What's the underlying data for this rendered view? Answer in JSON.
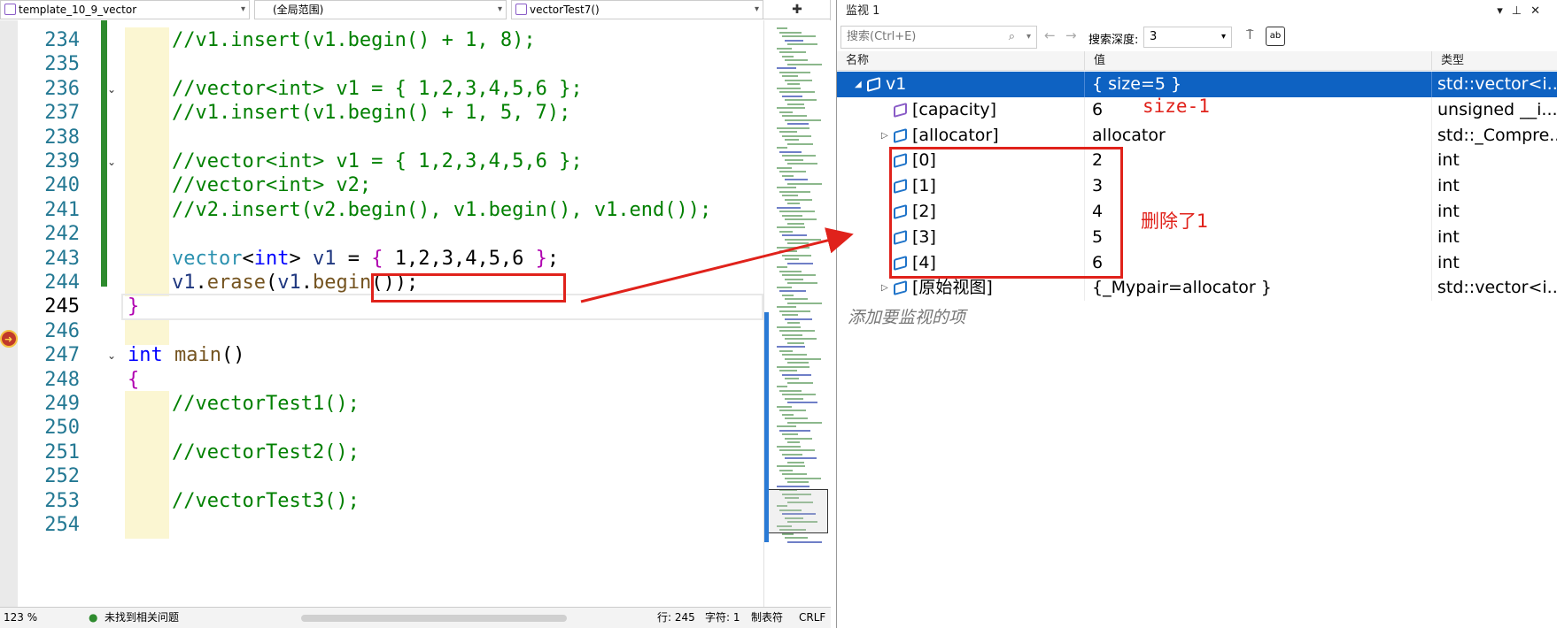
{
  "editor": {
    "dropdowns": [
      "template_10_9_vector",
      "(全局范围)",
      "vectorTest7()"
    ],
    "lines": [
      {
        "num": "234",
        "code": "//v1.insert(v1.begin() + 1, 8);",
        "kind": "comment"
      },
      {
        "num": "235",
        "code": "",
        "kind": "blank"
      },
      {
        "num": "236",
        "code": "//vector<int> v1 = { 1,2,3,4,5,6 };",
        "kind": "comment"
      },
      {
        "num": "237",
        "code": "//v1.insert(v1.begin() + 1, 5, 7);",
        "kind": "comment"
      },
      {
        "num": "238",
        "code": "",
        "kind": "blank"
      },
      {
        "num": "239",
        "code": "//vector<int> v1 = { 1,2,3,4,5,6 };",
        "kind": "comment"
      },
      {
        "num": "240",
        "code": "//vector<int> v2;",
        "kind": "comment"
      },
      {
        "num": "241",
        "code": "//v2.insert(v2.begin(), v1.begin(), v1.end());",
        "kind": "comment"
      },
      {
        "num": "242",
        "code": "",
        "kind": "blank"
      },
      {
        "num": "243",
        "code": "vector<int> v1 = { 1,2,3,4,5,6 };",
        "kind": "code"
      },
      {
        "num": "244",
        "code": "v1.erase(v1.begin());",
        "kind": "code"
      },
      {
        "num": "245",
        "code": "}",
        "kind": "code"
      },
      {
        "num": "246",
        "code": "",
        "kind": "blank"
      },
      {
        "num": "247",
        "code": "int main()",
        "kind": "code"
      },
      {
        "num": "248",
        "code": "{",
        "kind": "code"
      },
      {
        "num": "249",
        "code": "//vectorTest1();",
        "kind": "comment"
      },
      {
        "num": "250",
        "code": "",
        "kind": "blank"
      },
      {
        "num": "251",
        "code": "//vectorTest2();",
        "kind": "comment"
      },
      {
        "num": "252",
        "code": "",
        "kind": "blank"
      },
      {
        "num": "253",
        "code": "//vectorTest3();",
        "kind": "comment"
      },
      {
        "num": "254",
        "code": "",
        "kind": "blank"
      }
    ],
    "status": {
      "zoom": "123 %",
      "issues": "未找到相关问题",
      "line": "行: 245",
      "char": "字符: 1",
      "tab": "制表符",
      "eol": "CRLF"
    }
  },
  "watch": {
    "title": "监视 1",
    "search_placeholder": "搜索(Ctrl+E)",
    "search_depth_label": "搜索深度:",
    "search_depth_value": "3",
    "columns": [
      "名称",
      "值",
      "类型"
    ],
    "rows": [
      {
        "name": "v1",
        "value": "{ size=5 }",
        "type": "std::vector<i...",
        "expand": "open",
        "selected": true
      },
      {
        "name": "[capacity]",
        "value": "6",
        "type": "unsigned __i...",
        "expand": "none",
        "selected": false
      },
      {
        "name": "[allocator]",
        "value": "allocator",
        "type": "std::_Compre...",
        "expand": "closed",
        "selected": false
      },
      {
        "name": "[0]",
        "value": "2",
        "type": "int",
        "expand": "none",
        "selected": false
      },
      {
        "name": "[1]",
        "value": "3",
        "type": "int",
        "expand": "none",
        "selected": false
      },
      {
        "name": "[2]",
        "value": "4",
        "type": "int",
        "expand": "none",
        "selected": false
      },
      {
        "name": "[3]",
        "value": "5",
        "type": "int",
        "expand": "none",
        "selected": false
      },
      {
        "name": "[4]",
        "value": "6",
        "type": "int",
        "expand": "none",
        "selected": false
      },
      {
        "name": "[原始视图]",
        "value": "{_Mypair=allocator }",
        "type": "std::vector<i...",
        "expand": "closed",
        "selected": false
      }
    ],
    "add_item": "添加要监视的项"
  },
  "annotations": {
    "size_note": "size-1",
    "removed_note": "删除了1"
  },
  "colors": {
    "accent": "#0e62c2",
    "annotation": "#e0221b",
    "comment": "#008000",
    "keyword": "#0000ff"
  }
}
